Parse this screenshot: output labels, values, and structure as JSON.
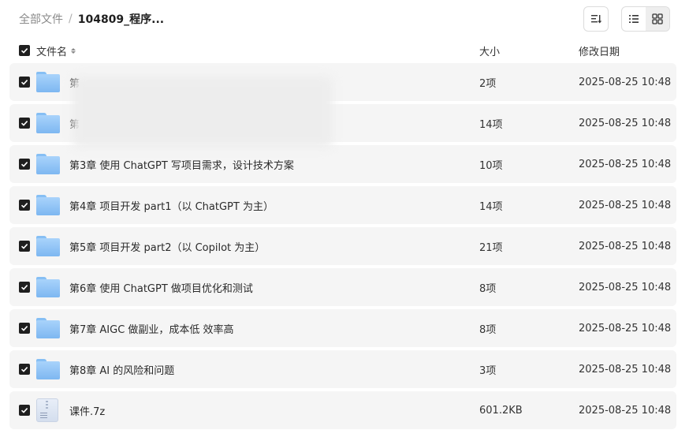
{
  "breadcrumb": {
    "root": "全部文件",
    "separator": "/",
    "current": "104809_程序..."
  },
  "toolbar": {
    "sort_icon": "sort-icon",
    "list_view_icon": "list-view-icon",
    "grid_view_icon": "grid-view-icon",
    "active_view": "grid"
  },
  "header": {
    "name": "文件名",
    "size": "大小",
    "date": "修改日期"
  },
  "rows": [
    {
      "name": "第",
      "size": "2项",
      "date": "2025-08-25 10:48",
      "type": "folder"
    },
    {
      "name": "第",
      "size": "14项",
      "date": "2025-08-25 10:48",
      "type": "folder"
    },
    {
      "name": "第3章 使用 ChatGPT 写项目需求，设计技术方案",
      "size": "10项",
      "date": "2025-08-25 10:48",
      "type": "folder"
    },
    {
      "name": "第4章 项目开发 part1（以 ChatGPT 为主）",
      "size": "14项",
      "date": "2025-08-25 10:48",
      "type": "folder"
    },
    {
      "name": "第5章 项目开发 part2（以 Copilot 为主）",
      "size": "21项",
      "date": "2025-08-25 10:48",
      "type": "folder"
    },
    {
      "name": "第6章 使用 ChatGPT 做项目优化和测试",
      "size": "8项",
      "date": "2025-08-25 10:48",
      "type": "folder"
    },
    {
      "name": "第7章 AIGC 做副业，成本低 效率高",
      "size": "8项",
      "date": "2025-08-25 10:48",
      "type": "folder"
    },
    {
      "name": "第8章 AI 的风险和问题",
      "size": "3项",
      "date": "2025-08-25 10:48",
      "type": "folder"
    },
    {
      "name": "课件.7z",
      "size": "601.2KB",
      "date": "2025-08-25 10:48",
      "type": "archive"
    }
  ],
  "colors": {
    "row_bg": "#f5f5f5",
    "folder_blue": "#8cc3f6",
    "checkbox": "#1f1f1f"
  }
}
